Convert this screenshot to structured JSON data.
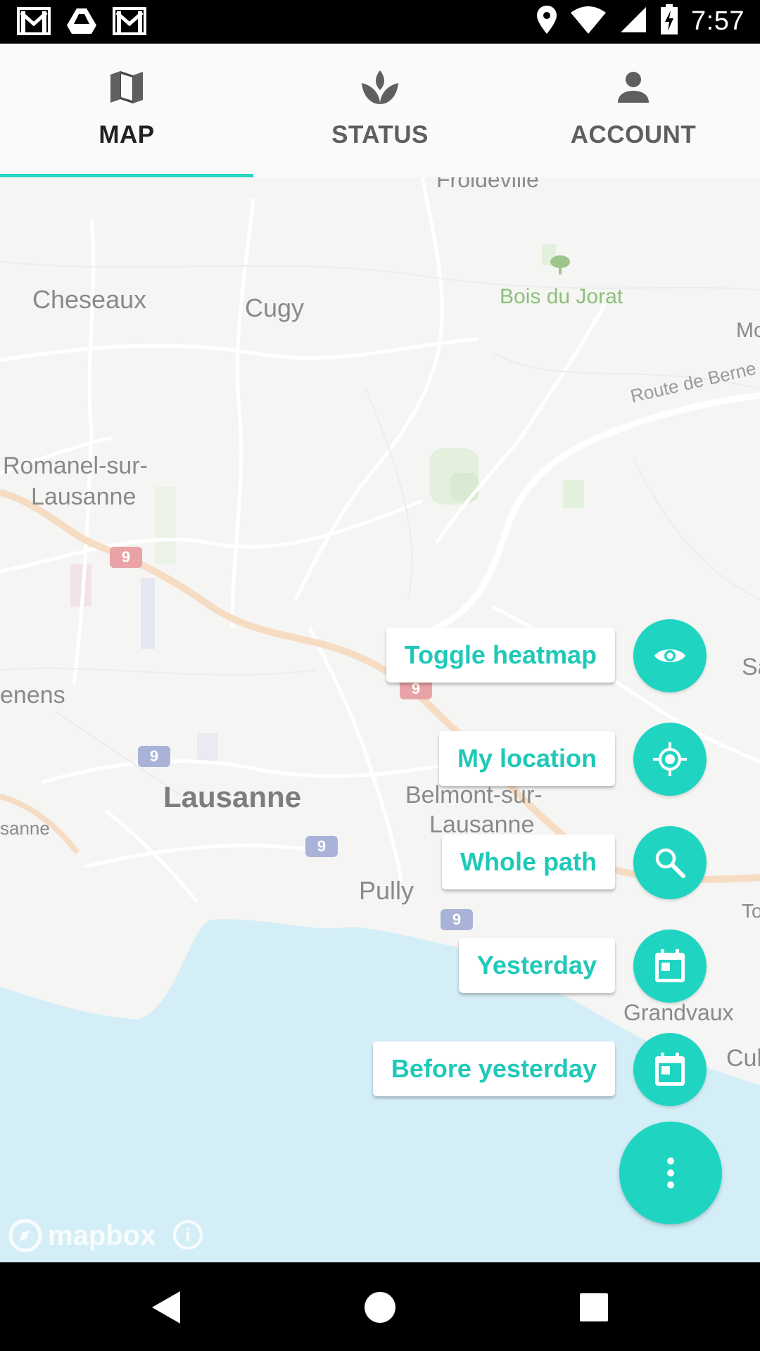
{
  "status_bar": {
    "time": "7:57",
    "left_icons": [
      "gmail-icon",
      "drive-icon",
      "gmail-icon"
    ],
    "right_icons": [
      "location-icon",
      "wifi-icon",
      "signal-icon",
      "battery-charging-icon"
    ]
  },
  "tabs": [
    {
      "label": "MAP",
      "icon": "map-icon",
      "active": true
    },
    {
      "label": "STATUS",
      "icon": "plant-icon",
      "active": false
    },
    {
      "label": "ACCOUNT",
      "icon": "person-icon",
      "active": false
    }
  ],
  "map": {
    "places": {
      "froideville": "Froideville",
      "cheseaux": "Cheseaux",
      "cugy": "Cugy",
      "bois_du_jorat": "Bois du Jorat",
      "route_de_berne": "Route de Berne",
      "romanel_line1": "Romanel-sur-",
      "romanel_line2": "Lausanne",
      "renens": "enens",
      "lausanne": "Lausanne",
      "lausanne_partial": "sanne",
      "belmont_line1": "Belmont-sur-",
      "belmont_line2": "Lausanne",
      "pully": "Pully",
      "grandvaux": "Grandvaux",
      "mo_partial": "Mo",
      "sav_partial": "Sav",
      "to_partial": "To",
      "cul_partial": "Cul"
    },
    "road_shields": [
      "9",
      "9",
      "9",
      "9",
      "9"
    ],
    "attribution": "mapbox"
  },
  "fab_menu": {
    "items": [
      {
        "label": "Toggle heatmap",
        "icon": "eye-icon"
      },
      {
        "label": "My location",
        "icon": "my-location-icon"
      },
      {
        "label": "Whole path",
        "icon": "search-icon"
      },
      {
        "label": "Yesterday",
        "icon": "calendar-icon"
      },
      {
        "label": "Before yesterday",
        "icon": "calendar-icon"
      }
    ],
    "main_icon": "more-vertical-icon"
  },
  "nav_bar": [
    "back-icon",
    "home-icon",
    "recents-icon"
  ],
  "colors": {
    "accent": "#1fd5c2",
    "tab_indicator": "#27d3c3",
    "water": "#d3eef7",
    "land": "#f5f5f4"
  }
}
